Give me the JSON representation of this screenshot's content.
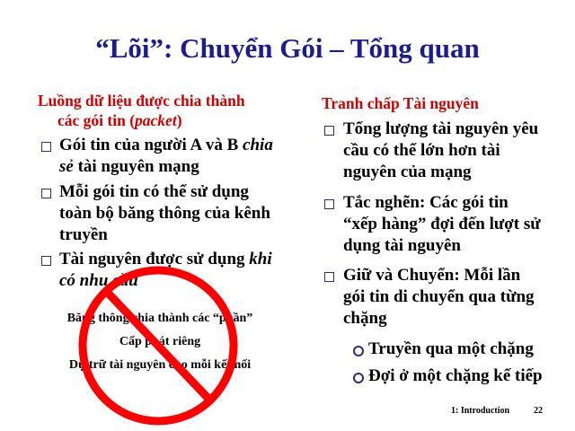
{
  "title": "“Lõi”: Chuyển Gói – Tổng quan",
  "left": {
    "heading": [
      "Luồng dữ liệu được chia thành",
      "các gói tin (",
      "packet",
      ")"
    ],
    "bullets": [
      {
        "lines": [
          "Gói tin của người A và B ",
          "chia",
          "sẻ",
          " tài nguyên mạng"
        ]
      },
      {
        "lines": [
          "Mỗi gói tin có thể sử dụng",
          "toàn bộ băng thông của kênh",
          "truyền"
        ]
      },
      {
        "lines": [
          "Tài nguyên được sử dụng ",
          "khi",
          "có nhu cầu"
        ]
      }
    ],
    "notes": [
      "Băng thông chia thành các “phần”",
      "Cấp phát riêng",
      "Dự trữ tài nguyên cho mỗi kết nối"
    ]
  },
  "right": {
    "heading": "Tranh chấp Tài nguyên",
    "bullets": [
      {
        "lines": [
          "Tổng lượng tài nguyên yêu",
          "cầu có thể lớn hơn tài",
          "nguyên của mạng"
        ]
      },
      {
        "lines": [
          "Tắc nghẽn: Các gói tin",
          "“xếp hàng” đợi đến lượt sử",
          "dụng tài nguyên"
        ]
      },
      {
        "lines": [
          "Giữ và Chuyển: Mỗi lần",
          "gói tin di chuyển qua từng",
          "chặng"
        ]
      }
    ],
    "subbullets": [
      "Truyền qua một chặng",
      "Đợi ở một chặng kế tiếp"
    ]
  },
  "footer": {
    "section": "1: Introduction",
    "page": "22"
  },
  "colors": {
    "title": "#1c1c8e",
    "heading": "#d00000",
    "bullet": "#2a2a90",
    "prohibit": "#ff0000"
  }
}
